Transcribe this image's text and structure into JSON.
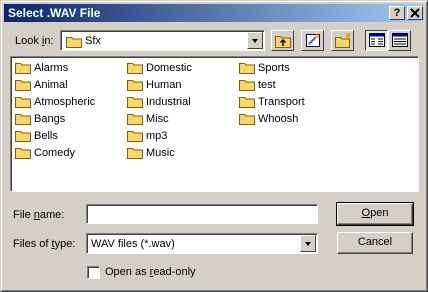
{
  "window": {
    "title": "Select .WAV File",
    "help_glyph": "?",
    "close_glyph": "✕"
  },
  "lookin": {
    "label_pre": "Look ",
    "label_key": "i",
    "label_post": "n:",
    "value": "Sfx"
  },
  "files": [
    {
      "name": "Alarms"
    },
    {
      "name": "Animal"
    },
    {
      "name": "Atmospheric"
    },
    {
      "name": "Bangs"
    },
    {
      "name": "Bells"
    },
    {
      "name": "Comedy"
    },
    {
      "name": "Domestic"
    },
    {
      "name": "Human"
    },
    {
      "name": "Industrial"
    },
    {
      "name": "Misc"
    },
    {
      "name": "mp3"
    },
    {
      "name": "Music"
    },
    {
      "name": "Sports"
    },
    {
      "name": "test"
    },
    {
      "name": "Transport"
    },
    {
      "name": "Whoosh"
    }
  ],
  "filename": {
    "label_pre": "File ",
    "label_key": "n",
    "label_post": "ame:",
    "value": ""
  },
  "filetype": {
    "label_pre": "Files of ",
    "label_key": "t",
    "label_post": "ype:",
    "value": "WAV files (*.wav)"
  },
  "buttons": {
    "open_key": "O",
    "open_rest": "pen",
    "cancel": "Cancel"
  },
  "readonly": {
    "label_pre": "Open as ",
    "label_key": "r",
    "label_post": "ead-only",
    "checked": false
  },
  "colors": {
    "title_start": "#0a246a",
    "title_end": "#a6caf0",
    "folder": "#f7d66b",
    "face": "#d4d0c8"
  }
}
